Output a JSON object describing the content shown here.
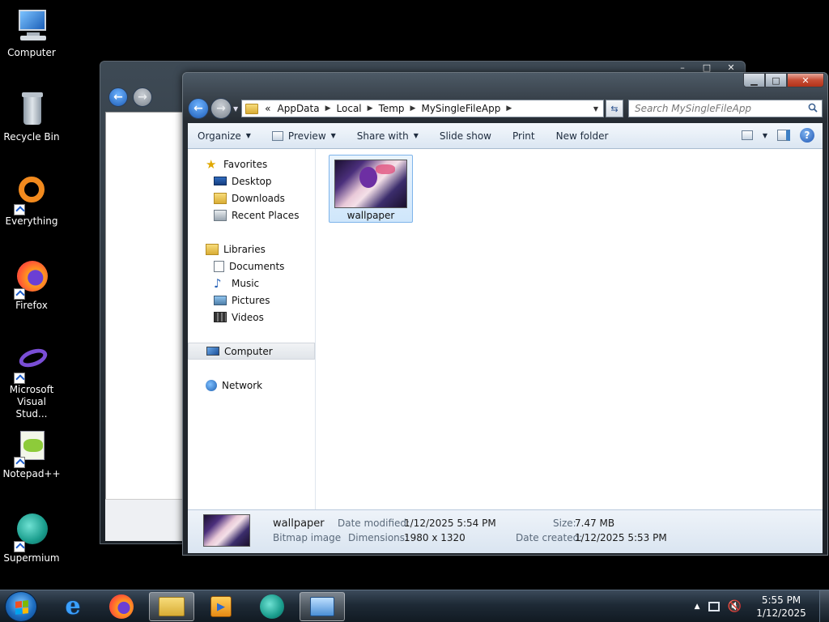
{
  "desktop": {
    "icons": [
      {
        "label": "Computer",
        "icon": "computer-icon"
      },
      {
        "label": "Recycle Bin",
        "icon": "recycle-bin-icon"
      },
      {
        "label": "Everything",
        "icon": "everything-icon"
      },
      {
        "label": "Firefox",
        "icon": "firefox-icon"
      },
      {
        "label": "Microsoft Visual Stud...",
        "icon": "visual-studio-icon"
      },
      {
        "label": "Notepad++",
        "icon": "notepad-plus-plus-icon"
      },
      {
        "label": "Supermium",
        "icon": "supermium-icon"
      }
    ]
  },
  "explorer": {
    "breadcrumb": {
      "overflow": "«",
      "parts": [
        "AppData",
        "Local",
        "Temp",
        "MySingleFileApp"
      ]
    },
    "search_placeholder": "Search MySingleFileApp",
    "toolbar": {
      "organize": "Organize",
      "preview": "Preview",
      "share_with": "Share with",
      "slide_show": "Slide show",
      "print": "Print",
      "new_folder": "New folder"
    },
    "nav": {
      "favorites": "Favorites",
      "desktop": "Desktop",
      "downloads": "Downloads",
      "recent_places": "Recent Places",
      "libraries": "Libraries",
      "documents": "Documents",
      "music": "Music",
      "pictures": "Pictures",
      "videos": "Videos",
      "computer": "Computer",
      "network": "Network"
    },
    "files": [
      {
        "name": "wallpaper",
        "selected": true
      }
    ],
    "details": {
      "name": "wallpaper",
      "type": "Bitmap image",
      "date_modified_label": "Date modified:",
      "date_modified": "1/12/2025 5:54 PM",
      "dimensions_label": "Dimensions:",
      "dimensions": "1980 x 1320",
      "size_label": "Size:",
      "size": "7.47 MB",
      "date_created_label": "Date created:",
      "date_created": "1/12/2025 5:53 PM"
    }
  },
  "taskbar": {
    "apps": [
      "internet-explorer-icon",
      "firefox-icon",
      "explorer-icon",
      "media-center-icon",
      "supermium-icon",
      "remote-desktop-icon"
    ],
    "time": "5:55 PM",
    "date": "1/12/2025"
  },
  "colors": {
    "selection": "#cfe6fb",
    "toolbar": "#dbe6f2",
    "close": "#c74d35"
  }
}
